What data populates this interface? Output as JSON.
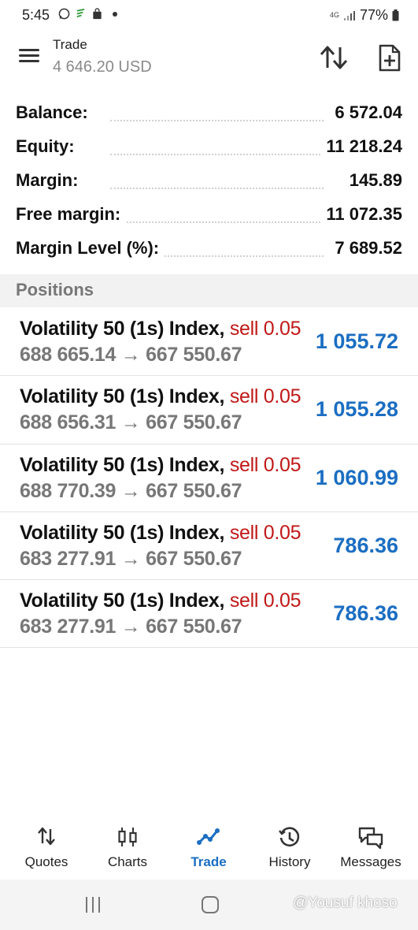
{
  "status_bar": {
    "time": "5:45",
    "network": "4G",
    "battery": "77%"
  },
  "header": {
    "title": "Trade",
    "subtitle": "4 646.20 USD"
  },
  "summary": [
    {
      "label": "Balance:",
      "value": "6 572.04"
    },
    {
      "label": "Equity:",
      "value": "11 218.24"
    },
    {
      "label": "Margin:",
      "value": "145.89"
    },
    {
      "label": "Free margin:",
      "value": "11 072.35"
    },
    {
      "label": "Margin Level (%):",
      "value": "7 689.52"
    }
  ],
  "positions_header": "Positions",
  "positions": [
    {
      "symbol": "Volatility 50 (1s) Index,",
      "type": "sell 0.05",
      "open_price": "688 665.14",
      "arrow": "→",
      "current_price": "667 550.67",
      "profit": "1 055.72"
    },
    {
      "symbol": "Volatility 50 (1s) Index,",
      "type": "sell 0.05",
      "open_price": "688 656.31",
      "arrow": "→",
      "current_price": "667 550.67",
      "profit": "1 055.28"
    },
    {
      "symbol": "Volatility 50 (1s) Index,",
      "type": "sell 0.05",
      "open_price": "688 770.39",
      "arrow": "→",
      "current_price": "667 550.67",
      "profit": "1 060.99"
    },
    {
      "symbol": "Volatility 50 (1s) Index,",
      "type": "sell 0.05",
      "open_price": "683 277.91",
      "arrow": "→",
      "current_price": "667 550.67",
      "profit": "786.36"
    },
    {
      "symbol": "Volatility 50 (1s) Index,",
      "type": "sell 0.05",
      "open_price": "683 277.91",
      "arrow": "→",
      "current_price": "667 550.67",
      "profit": "786.36"
    }
  ],
  "bottom_nav": [
    {
      "label": "Quotes",
      "icon": "quotes-icon"
    },
    {
      "label": "Charts",
      "icon": "charts-icon"
    },
    {
      "label": "Trade",
      "icon": "trade-icon",
      "active": true
    },
    {
      "label": "History",
      "icon": "history-icon"
    },
    {
      "label": "Messages",
      "icon": "messages-icon"
    }
  ],
  "watermark": "@Yousuf khoso",
  "colors": {
    "accent": "#1b6ec2",
    "sell": "#c01818",
    "muted": "#777777"
  }
}
